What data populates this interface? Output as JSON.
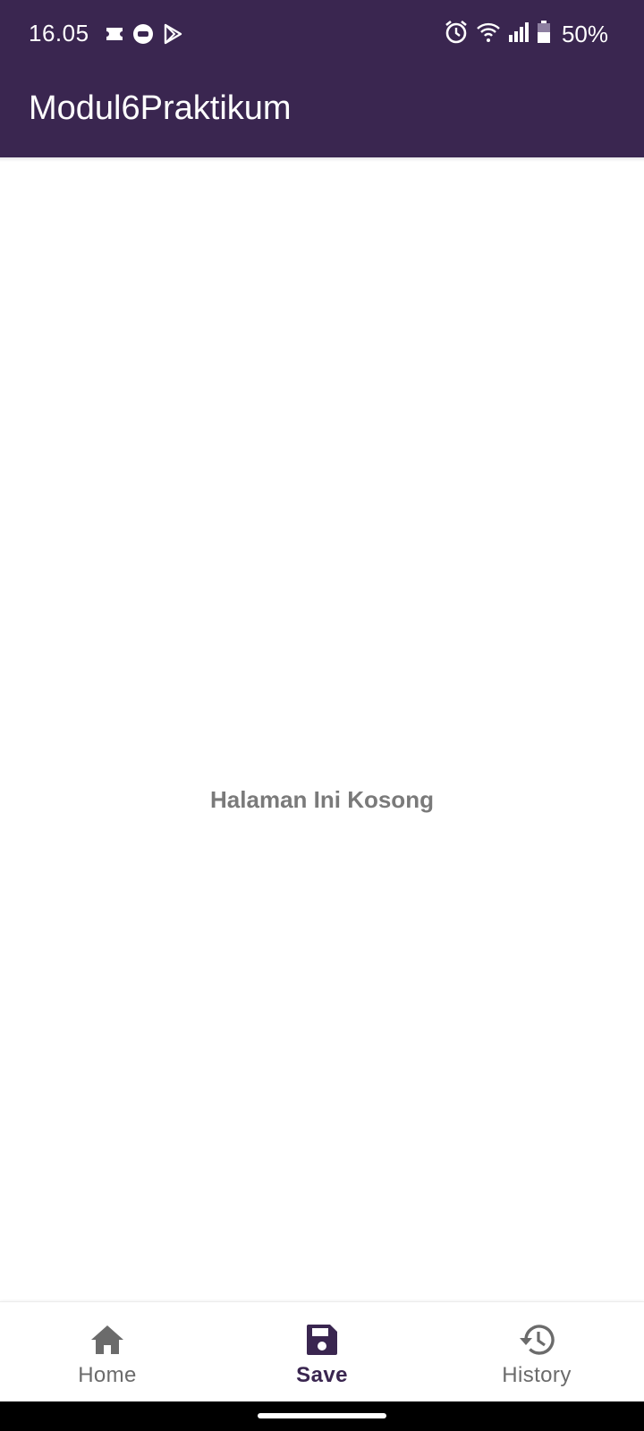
{
  "status_bar": {
    "time": "16.05",
    "battery_text": "50%",
    "left_icons": [
      "notification-ticket-icon",
      "notification-chat-icon",
      "play-store-icon"
    ],
    "right_icons": [
      "alarm-icon",
      "wifi-icon",
      "signal-icon",
      "battery-icon"
    ]
  },
  "app_bar": {
    "title": "Modul6Praktikum",
    "color": "#3a2650"
  },
  "main": {
    "empty_message": "Halaman Ini Kosong"
  },
  "bottom_nav": {
    "items": [
      {
        "label": "Home",
        "icon": "home-icon",
        "active": false
      },
      {
        "label": "Save",
        "icon": "save-icon",
        "active": true
      },
      {
        "label": "History",
        "icon": "history-icon",
        "active": false
      }
    ],
    "active_color": "#3a2650",
    "inactive_color": "#6b6b6b"
  }
}
